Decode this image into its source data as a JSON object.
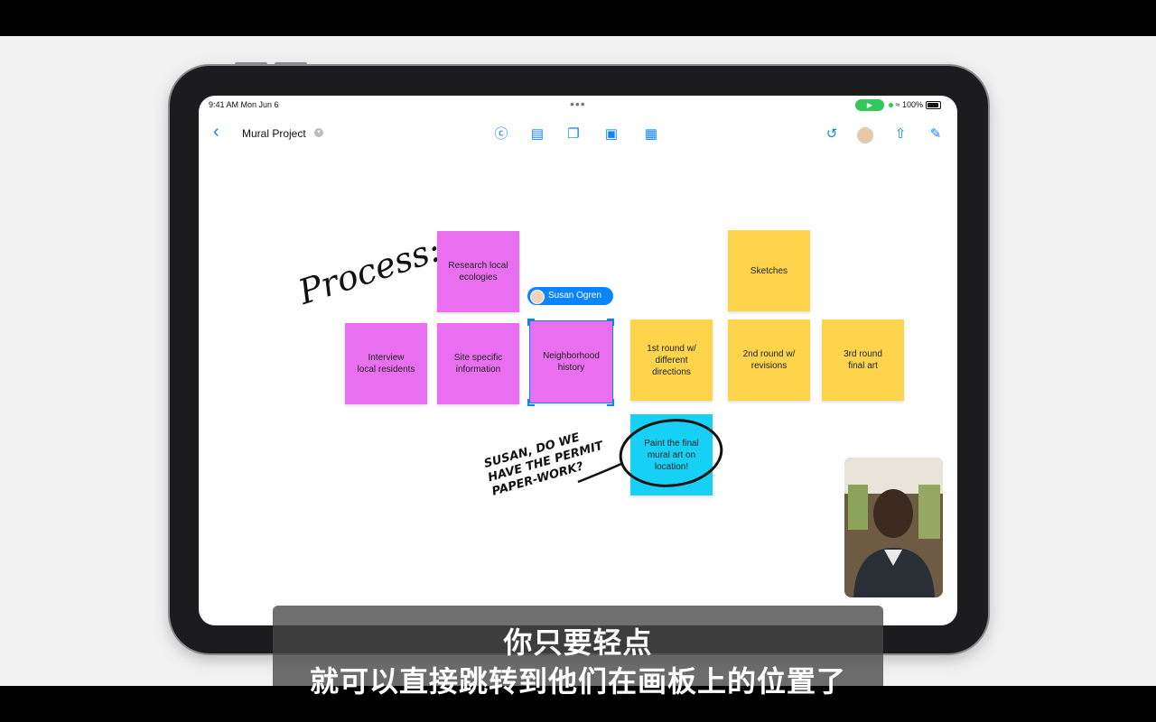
{
  "status": {
    "time": "9:41 AM  Mon Jun 6",
    "battery": "100%"
  },
  "toolbar": {
    "title": "Mural Project",
    "icons": [
      "back-chevron-icon",
      "pen-tool-icon",
      "text-box-icon",
      "shapes-icon",
      "text-tool-icon",
      "media-icon",
      "undo-icon",
      "collaborator-avatar-icon",
      "share-icon",
      "compose-icon"
    ]
  },
  "board": {
    "process_label": "Process:",
    "notes": {
      "research": "Research local\necologies",
      "interview": "Interview\nlocal residents",
      "site": "Site specific\ninformation",
      "neighborhood": "Neighborhood\nhistory",
      "first_round": "1st round w/\ndifferent\ndirections",
      "sketches": "Sketches",
      "second_round": "2nd round w/\nrevisions",
      "third_round": "3rd round\nfinal art",
      "paint": "Paint the final\nmural art on\nlocation!"
    },
    "collaborator_tag": "Susan Ogren",
    "handwritten_note": "SUSAN, DO WE HAVE THE PERMIT PAPER-WORK?",
    "colors": {
      "pink": "#e96ef0",
      "yellow": "#fdd44c",
      "cyan": "#16d1f5",
      "accent": "#0a84ff"
    }
  },
  "subtitles": {
    "line1": "你只要轻点",
    "line2": "就可以直接跳转到他们在画板上的位置了"
  }
}
